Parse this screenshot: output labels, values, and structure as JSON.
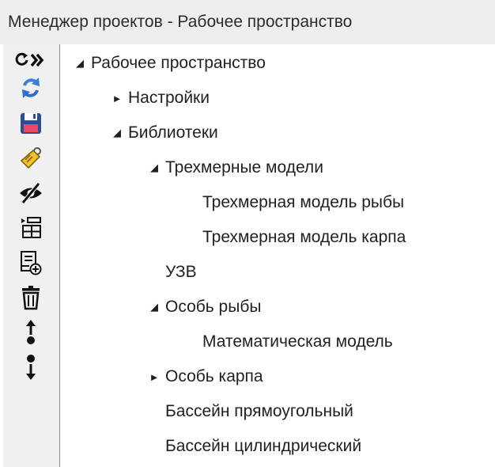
{
  "window": {
    "title": "Менеджер проектов - Рабочее пространство"
  },
  "toolbar": {
    "buttons": [
      {
        "name": "refresh-expand",
        "icon": "refresh-expand-icon"
      },
      {
        "name": "sync",
        "icon": "sync-icon"
      },
      {
        "name": "save",
        "icon": "save-icon"
      },
      {
        "name": "tag",
        "icon": "tag-icon"
      },
      {
        "name": "hide",
        "icon": "eye-hidden-icon"
      },
      {
        "name": "table-tree",
        "icon": "table-tree-icon"
      },
      {
        "name": "add-document",
        "icon": "add-document-icon"
      },
      {
        "name": "delete",
        "icon": "trash-icon"
      },
      {
        "name": "move-up",
        "icon": "move-up-icon"
      },
      {
        "name": "move-down",
        "icon": "move-down-icon"
      }
    ]
  },
  "tree": {
    "nodes": [
      {
        "label": "Рабочее пространство",
        "level": 0,
        "state": "expanded"
      },
      {
        "label": "Настройки",
        "level": 1,
        "state": "collapsed"
      },
      {
        "label": "Библиотеки",
        "level": 1,
        "state": "expanded"
      },
      {
        "label": "Трехмерные модели",
        "level": 2,
        "state": "expanded"
      },
      {
        "label": "Трехмерная модель рыбы",
        "level": 3,
        "state": "leaf"
      },
      {
        "label": "Трехмерная модель карпа",
        "level": 3,
        "state": "leaf"
      },
      {
        "label": "УЗВ",
        "level": 2,
        "state": "leaf"
      },
      {
        "label": "Особь рыбы",
        "level": 2,
        "state": "expanded"
      },
      {
        "label": "Математическая модель",
        "level": 3,
        "state": "leaf"
      },
      {
        "label": "Особь карпа",
        "level": 2,
        "state": "collapsed"
      },
      {
        "label": "Бассейн прямоугольный",
        "level": 2,
        "state": "leaf"
      },
      {
        "label": "Бассейн цилиндрический",
        "level": 2,
        "state": "leaf"
      }
    ],
    "glyphs": {
      "expanded": "◢",
      "collapsed": "►"
    }
  }
}
